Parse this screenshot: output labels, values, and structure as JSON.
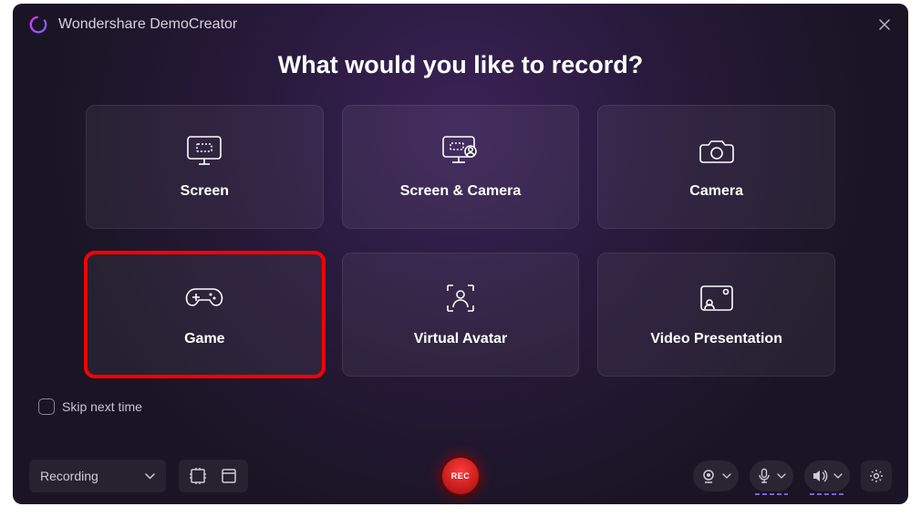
{
  "app": {
    "title": "Wondershare DemoCreator"
  },
  "heading": "What would you like to record?",
  "cards": [
    {
      "id": "screen",
      "label": "Screen"
    },
    {
      "id": "screen-camera",
      "label": "Screen & Camera"
    },
    {
      "id": "camera",
      "label": "Camera"
    },
    {
      "id": "game",
      "label": "Game",
      "highlighted": true
    },
    {
      "id": "virtual-avatar",
      "label": "Virtual Avatar"
    },
    {
      "id": "video-presentation",
      "label": "Video Presentation"
    }
  ],
  "skip": {
    "label": "Skip next time",
    "checked": false
  },
  "bottombar": {
    "mode": "Recording",
    "record_label": "REC"
  }
}
